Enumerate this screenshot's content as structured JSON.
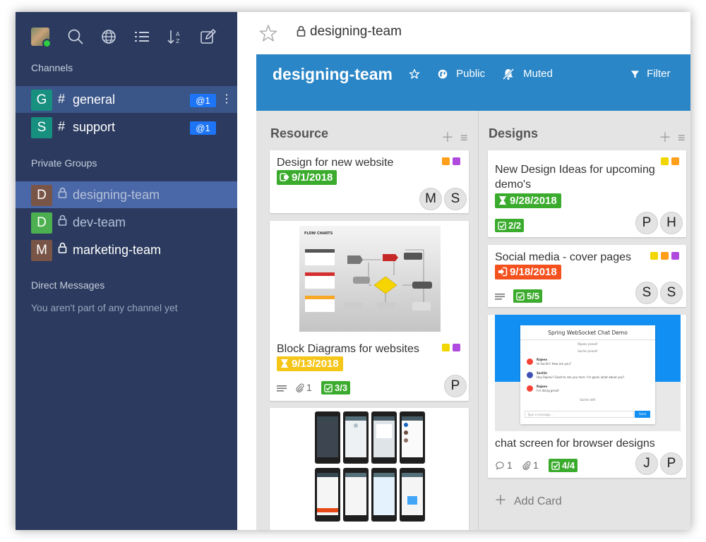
{
  "sidebar": {
    "sections": {
      "channels": "Channels",
      "private_groups": "Private Groups",
      "direct_messages": "Direct Messages"
    },
    "channels": [
      {
        "letter": "G",
        "name": "general",
        "badge": "@1",
        "color": "#17907f"
      },
      {
        "letter": "S",
        "name": "support",
        "badge": "@1",
        "color": "#17907f"
      }
    ],
    "groups": [
      {
        "letter": "D",
        "name": "designing-team",
        "color": "#795548"
      },
      {
        "letter": "D",
        "name": "dev-team",
        "color": "#4caf50"
      },
      {
        "letter": "M",
        "name": "marketing-team",
        "color": "#795548"
      }
    ],
    "dm_empty": "You aren't part of any channel yet"
  },
  "header": {
    "title": "designing-team"
  },
  "banner": {
    "title": "designing-team",
    "public_label": "Public",
    "muted_label": "Muted",
    "filter_label": "Filter"
  },
  "lists": [
    {
      "title": "Resource",
      "cards": [
        {
          "title": "Design for new website",
          "date": "9/1/2018",
          "members": [
            "M",
            "S"
          ]
        },
        {
          "title": "Block Diagrams for websites",
          "date": "9/13/2018",
          "attachments": "1",
          "checklist": "3/3",
          "members": [
            "P"
          ]
        }
      ]
    },
    {
      "title": "Designs",
      "cards": [
        {
          "title": "New Design Ideas for upcoming demo's",
          "date": "9/28/2018",
          "checklist": "2/2",
          "members": [
            "P",
            "H"
          ]
        },
        {
          "title": "Social media - cover pages",
          "date": "9/18/2018",
          "checklist": "5/5",
          "members": [
            "S",
            "S"
          ]
        },
        {
          "title": "chat screen for browser designs",
          "comments": "1",
          "attachments": "1",
          "checklist": "4/4",
          "members": [
            "J",
            "P"
          ]
        }
      ],
      "add_card": "Add Card"
    }
  ],
  "chat_thumb": {
    "heading": "Spring WebSocket Chat Demo",
    "joined_1": "Rajeev joined!",
    "joined_2": "Sachin joined!",
    "m1_name": "Rajeev",
    "m1_text": "Hi Sachin! How are you?",
    "m2_name": "Sachin",
    "m2_text": "Hey Rajeev! Good to see you here. I'm good, what about you?",
    "m3_name": "Rajeev",
    "m3_text": "I'm doing great!",
    "left": "Sachin left!",
    "placeholder": "Type a message...",
    "send": "Send"
  },
  "flow_thumb": {
    "heading": "FLOW CHARTS"
  },
  "colors": {
    "sidebar": "#2b3a5e",
    "banner": "#2a86c7",
    "badge": "#1d74f5",
    "date_green": "#3aab2c",
    "date_yellow": "#f5c518",
    "date_red": "#f4511e",
    "label_orange": "#ff9f1a",
    "label_purple": "#b04adf",
    "label_yellow": "#f2d600"
  }
}
